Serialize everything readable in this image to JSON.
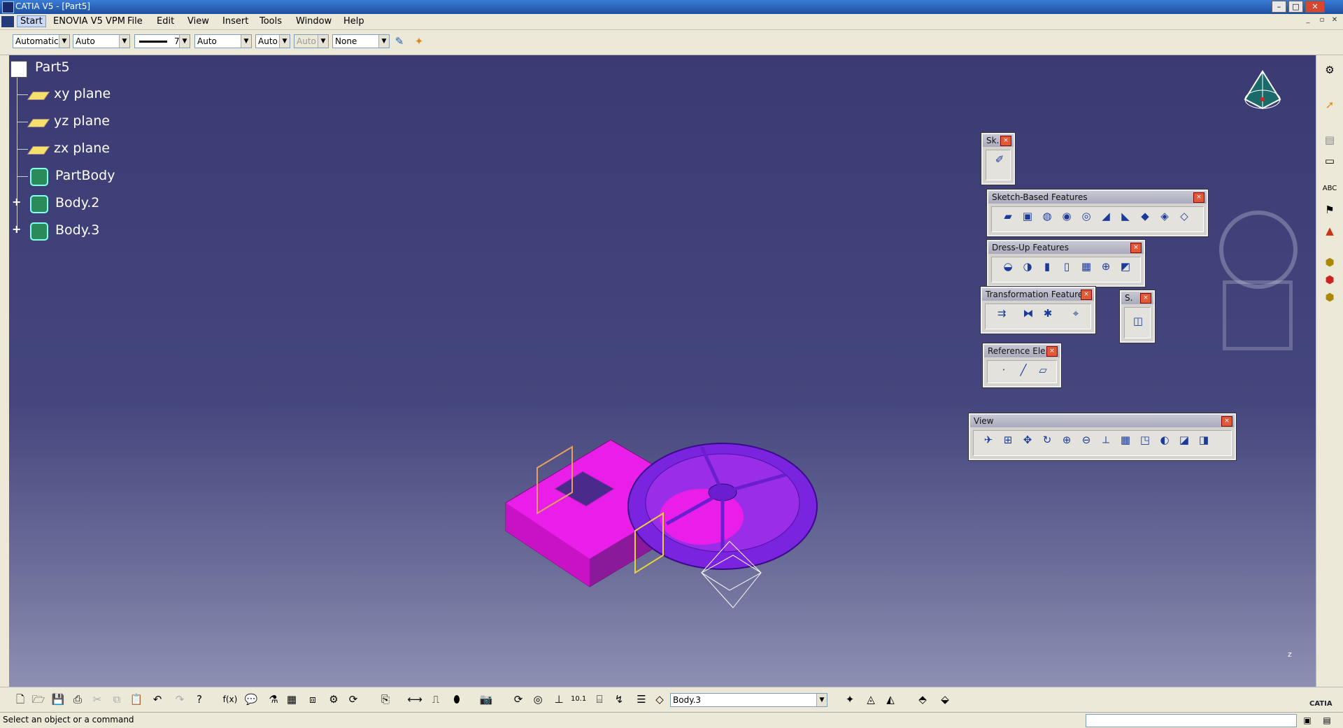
{
  "window": {
    "title": "CATIA V5 - [Part5]"
  },
  "menu": {
    "items": [
      "Start",
      "ENOVIA V5 VPM",
      "File",
      "Edit",
      "View",
      "Insert",
      "Tools",
      "Window",
      "Help"
    ]
  },
  "graphic_properties": {
    "color": "Automatic",
    "transparency": "Auto",
    "line_thickness": "7",
    "line_type": "Auto",
    "point_symbol": "Auto",
    "layer_disabled": "Auto",
    "layer": "None"
  },
  "tree": {
    "root": "Part5",
    "items": [
      "xy plane",
      "yz plane",
      "zx plane",
      "PartBody",
      "Body.2",
      "Body.3"
    ]
  },
  "palettes": {
    "sketcher": "Sk.",
    "sketch_based": "Sketch-Based Features",
    "dress_up": "Dress-Up Features",
    "transformation": "Transformation Features",
    "surface_based": "S.",
    "reference": "Reference Ele...",
    "view": "View"
  },
  "current_body": "Body.3",
  "status": {
    "message": "Select an object or a command"
  },
  "compass_axis_label": "z",
  "brand": "CATIA",
  "colors": {
    "part": "#e91ee8",
    "body_purple": "#7a24e0",
    "highlight_yellow": "#e8d23a"
  }
}
